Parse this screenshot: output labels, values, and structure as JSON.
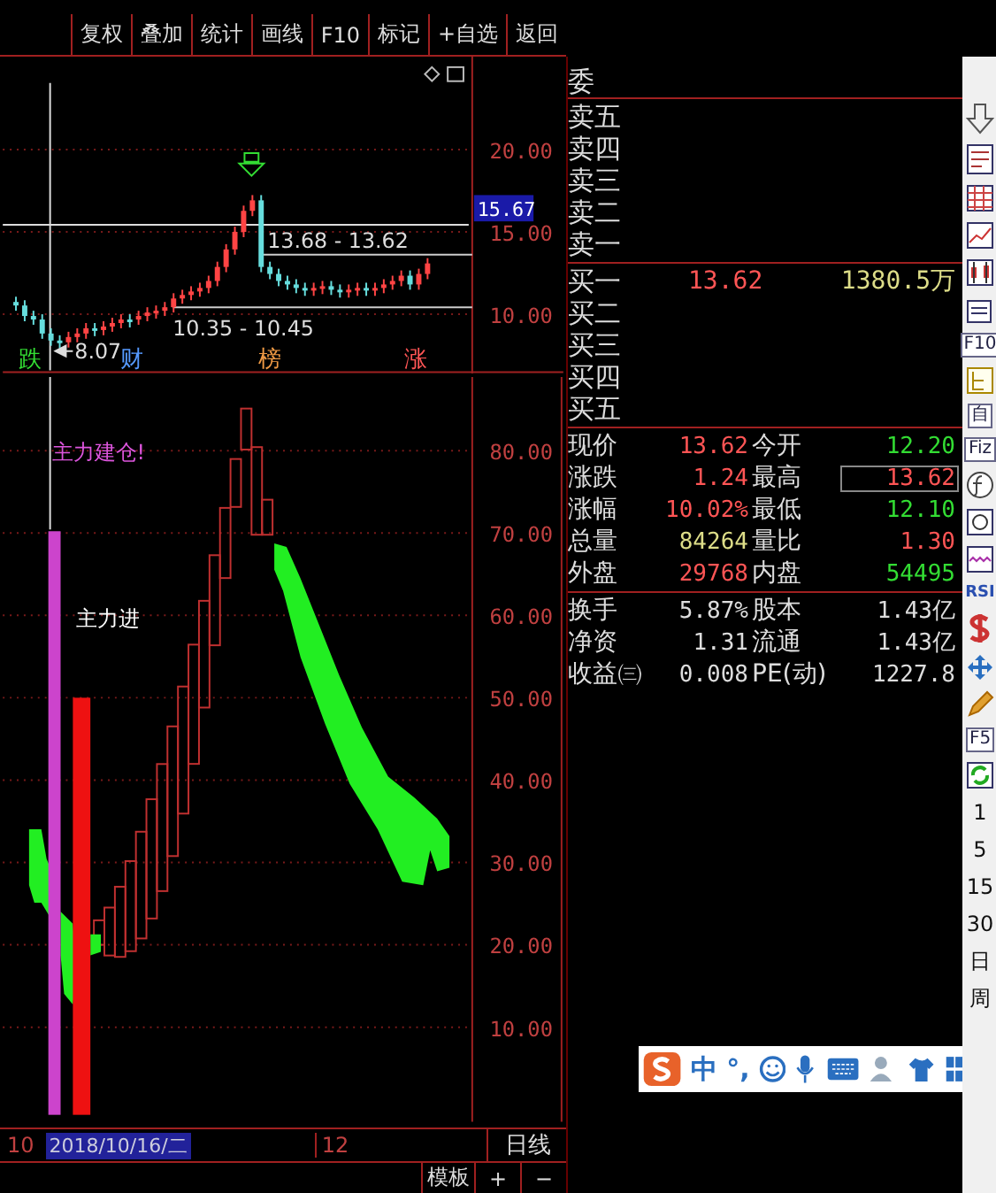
{
  "toolbar": {
    "buttons": [
      "复权",
      "叠加",
      "统计",
      "画线",
      "F10",
      "标记",
      "+自选",
      "返回"
    ]
  },
  "price_chart": {
    "axis_labels": [
      "20.00",
      "15.00",
      "10.00"
    ],
    "cursor_price": "15.67",
    "range_high": "13.68 - 13.62",
    "range_low": "10.35 - 10.45",
    "low_mark": "8.07",
    "event_marks": [
      {
        "text": "跌",
        "color": "#33dd33"
      },
      {
        "text": "财",
        "color": "#5599ff"
      },
      {
        "text": "榜",
        "color": "#ee9944"
      },
      {
        "text": "涨",
        "color": "#ff5555"
      }
    ]
  },
  "indicator_chart": {
    "axis_labels": [
      "80.00",
      "70.00",
      "60.00",
      "50.00",
      "40.00",
      "30.00",
      "20.00",
      "10.00"
    ],
    "build_label": "主力建仓!",
    "enter_label": "主力进"
  },
  "time_axis": {
    "labels": [
      "10",
      "12"
    ],
    "cursor_date": "2018/10/16/二",
    "period": "日线"
  },
  "bottom_bar": {
    "buttons": [
      "模板",
      "+",
      "−"
    ]
  },
  "quote_panel": {
    "header": "委",
    "asks": [
      {
        "label": "卖五"
      },
      {
        "label": "卖四"
      },
      {
        "label": "卖三"
      },
      {
        "label": "卖二"
      },
      {
        "label": "卖一"
      }
    ],
    "bids": [
      {
        "label": "买一",
        "price": "13.62",
        "volume": "1380.5万"
      },
      {
        "label": "买二"
      },
      {
        "label": "买三"
      },
      {
        "label": "买四"
      },
      {
        "label": "买五"
      }
    ],
    "stats": [
      {
        "cells": [
          {
            "label": "现价",
            "value": "13.62",
            "color": "#ff5555",
            "boxed": false
          },
          {
            "label": "今开",
            "value": "12.20",
            "color": "#33dd33",
            "boxed": false
          }
        ]
      },
      {
        "cells": [
          {
            "label": "涨跌",
            "value": "1.24",
            "color": "#ff5555",
            "boxed": false
          },
          {
            "label": "最高",
            "value": "13.62",
            "color": "#ff5555",
            "boxed": true
          }
        ]
      },
      {
        "cells": [
          {
            "label": "涨幅",
            "value": "10.02%",
            "color": "#ff5555",
            "boxed": false
          },
          {
            "label": "最低",
            "value": "12.10",
            "color": "#33dd33",
            "boxed": false
          }
        ]
      },
      {
        "cells": [
          {
            "label": "总量",
            "value": "84264",
            "color": "#dddd88",
            "boxed": false
          },
          {
            "label": "量比",
            "value": "1.30",
            "color": "#ff5555",
            "boxed": false
          }
        ]
      },
      {
        "cells": [
          {
            "label": "外盘",
            "value": "29768",
            "color": "#ff5555",
            "boxed": false
          },
          {
            "label": "内盘",
            "value": "54495",
            "color": "#33dd33",
            "boxed": false
          }
        ]
      }
    ],
    "fundamentals": [
      {
        "cells": [
          {
            "label": "换手",
            "value": "5.87%"
          },
          {
            "label": "股本",
            "value": "1.43亿"
          }
        ]
      },
      {
        "cells": [
          {
            "label": "净资",
            "value": "1.31"
          },
          {
            "label": "流通",
            "value": "1.43亿"
          }
        ]
      },
      {
        "cells": [
          {
            "label": "收益㈢",
            "value": "0.008"
          },
          {
            "label": "PE(动)",
            "value": "1227.8"
          }
        ]
      }
    ]
  },
  "side_toolbar": {
    "labels": [
      "F10",
      "自",
      "Fiz",
      "RSI",
      "F5"
    ],
    "periods": [
      "1",
      "5",
      "15",
      "30",
      "日",
      "周"
    ]
  },
  "ime_bar": {
    "mode": "中",
    "punctuation": "°,"
  }
}
